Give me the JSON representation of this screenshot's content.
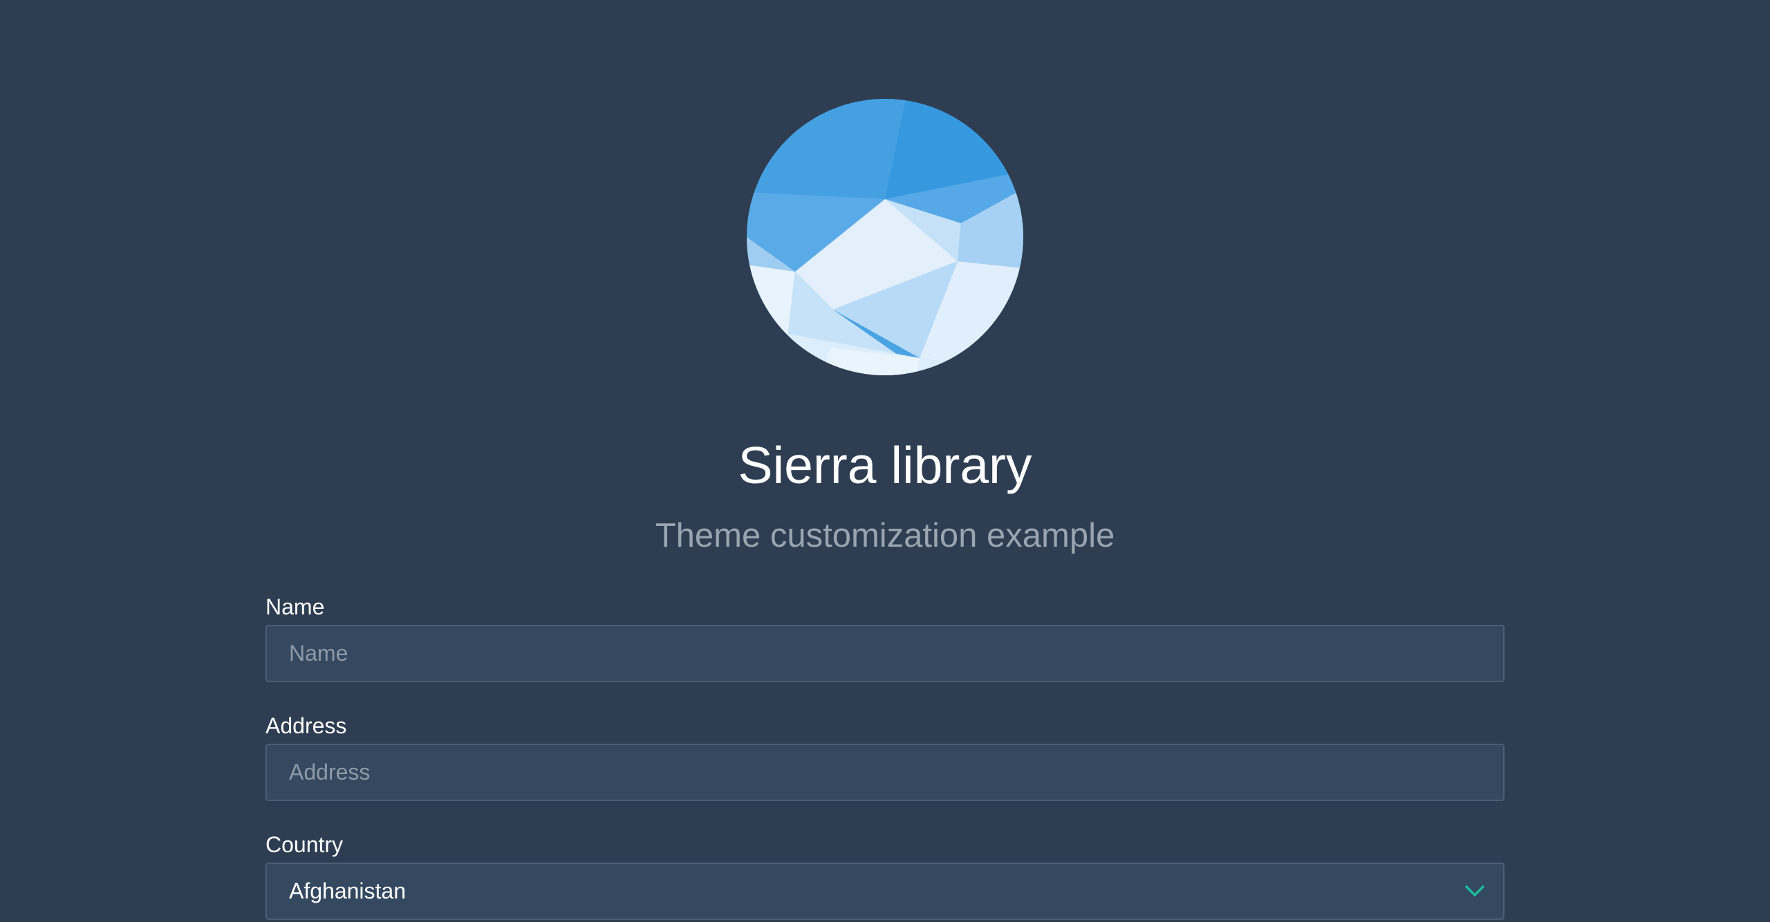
{
  "header": {
    "title": "Sierra library",
    "subtitle": "Theme customization example",
    "logo_icon": "mountain-logo-icon"
  },
  "form": {
    "name": {
      "label": "Name",
      "placeholder": "Name",
      "value": ""
    },
    "address": {
      "label": "Address",
      "placeholder": "Address",
      "value": ""
    },
    "country": {
      "label": "Country",
      "selected": "Afghanistan",
      "icon": "chevron-down-icon"
    }
  },
  "colors": {
    "background": "#2e3d51",
    "input_background": "#34485f",
    "input_border": "#4b5e74",
    "accent": "#1abc9c",
    "text": "#ffffff",
    "muted_text": "#9aa4b1"
  }
}
